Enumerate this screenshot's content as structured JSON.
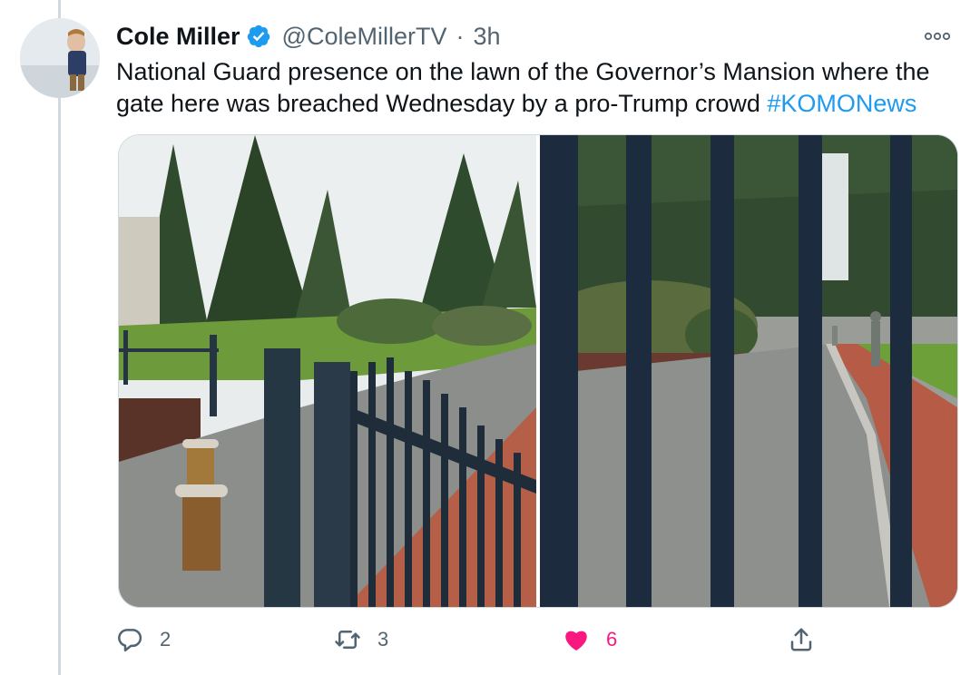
{
  "author": {
    "name": "Cole Miller",
    "handle": "@ColeMillerTV",
    "time": "3h",
    "separator": "·",
    "verified": true
  },
  "tweet": {
    "text": "National Guard presence on the lawn of the Governor’s Mansion where the gate here was breached Wednesday by a pro-Trump crowd ",
    "hashtag": "#KOMONews"
  },
  "stats": {
    "replies": "2",
    "retweets": "3",
    "likes": "6"
  },
  "icons": {
    "more": "more-horizontal-icon",
    "reply": "reply-bubble-icon",
    "retweet": "retweet-icon",
    "like": "heart-filled-icon",
    "share": "share-icon",
    "verified": "verified-badge-icon"
  },
  "colors": {
    "accent": "#1d9bf0",
    "like": "#f91880",
    "secondary_text": "#536471",
    "thread_line": "#cfd9de"
  }
}
